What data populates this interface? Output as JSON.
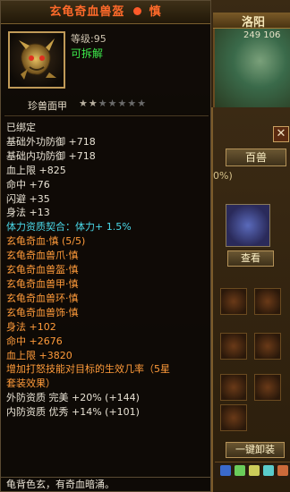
{
  "background": {
    "city_name": "洛阳",
    "coords": "249 106",
    "beast_tab": "百兽",
    "percent_text": "0%)",
    "view_button": "查看",
    "equip_all_button": "一键卸装",
    "close_symbol": "✕"
  },
  "tooltip": {
    "title": "玄龟奇血兽盔",
    "title_suffix": "慎",
    "level_text": "等级:95",
    "dismantle_text": "可拆解",
    "subtitle": "珍兽面甲",
    "stars_total": 7,
    "stars_filled": 2,
    "lines": [
      {
        "text": "已绑定",
        "color": "white"
      },
      {
        "text": "基础外功防御 +718",
        "color": "white"
      },
      {
        "text": "基础内功防御 +718",
        "color": "white"
      },
      {
        "text": "血上限 +825",
        "color": "white"
      },
      {
        "text": "命中 +76",
        "color": "white"
      },
      {
        "text": "闪避 +35",
        "color": "white"
      },
      {
        "text": "身法 +13",
        "color": "white"
      },
      {
        "text": "体力资质契合：体力+ 1.5%",
        "color": "cyan"
      },
      {
        "text": "玄龟奇血·慎 (5/5)",
        "color": "orange"
      },
      {
        "text": "玄龟奇血兽爪·慎",
        "color": "orange"
      },
      {
        "text": "玄龟奇血兽盔·慎",
        "color": "orange"
      },
      {
        "text": "玄龟奇血兽甲·慎",
        "color": "orange"
      },
      {
        "text": "玄龟奇血兽环·慎",
        "color": "orange"
      },
      {
        "text": "玄龟奇血兽饰·慎",
        "color": "orange"
      },
      {
        "text": "身法 +102",
        "color": "orange"
      },
      {
        "text": "命中 +2676",
        "color": "orange"
      },
      {
        "text": "血上限 +3820",
        "color": "orange"
      },
      {
        "text": "增加打怒技能对目标的生效几率（5星",
        "color": "orange"
      },
      {
        "text": "套装效果）",
        "color": "orange"
      },
      {
        "text": "外防资质  完美 +20% (+144)",
        "color": "white"
      },
      {
        "text": "内防资质  优秀 +14% (+101)",
        "color": "white"
      }
    ],
    "description": "龟背色玄，有奇血暗涌。"
  },
  "colors": {
    "title": "#ff6a2a",
    "white": "#e8e2d4",
    "cyan": "#4ad8e8",
    "orange": "#ff9b3a",
    "green": "#54e054"
  }
}
